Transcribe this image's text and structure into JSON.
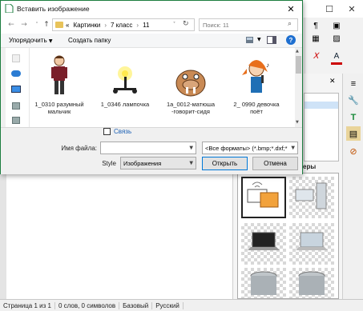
{
  "dialog": {
    "title": "Вставить изображение",
    "breadcrumb": [
      "Картинки",
      "7 класс",
      "11"
    ],
    "breadcrumb_prefix": "«",
    "search_placeholder": "Поиск: 11",
    "organize_label": "Упорядочить",
    "new_folder_label": "Создать папку",
    "files": [
      {
        "name": "1_0310 разумный мальчик",
        "icon": "boy-clipart"
      },
      {
        "name": "1_0346 лампочка",
        "icon": "lamp-clipart"
      },
      {
        "name": "1а_0012-матюша -говорит-сидя",
        "icon": "walrus-clipart"
      },
      {
        "name": "2_ 0990 девочка поёт",
        "icon": "singing-girl-clipart"
      }
    ],
    "link_label": "Связь",
    "link_checked": false,
    "filename_label": "Имя файла:",
    "filename_value": "",
    "filter_value": "<Все форматы> (*.bmp;*.dxf;*",
    "style_label": "Style",
    "style_value": "Изображения",
    "open_label": "Открыть",
    "cancel_label": "Отмена"
  },
  "app": {
    "gallery_title": "еры",
    "status": [
      "Страница 1 из 1",
      "0 слов, 0 символов",
      "Базовый",
      "Русский"
    ]
  },
  "colors": {
    "accent": "#0078d7",
    "dialog_border": "#1c7d3f",
    "link_text": "#1a5fb4"
  }
}
